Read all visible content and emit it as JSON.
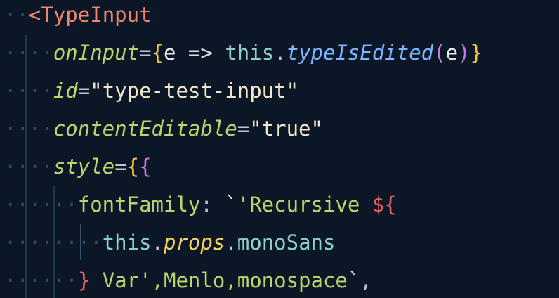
{
  "code": {
    "lines": [
      {
        "ws": "··",
        "tokens": [
          {
            "t": "<",
            "c": "tag"
          },
          {
            "t": "TypeInput",
            "c": "tag"
          }
        ]
      },
      {
        "ws": "····",
        "tokens": [
          {
            "t": "onInput",
            "c": "attr"
          },
          {
            "t": "=",
            "c": "eq"
          },
          {
            "t": "{",
            "c": "brace-y"
          },
          {
            "t": "e ",
            "c": "ident"
          },
          {
            "t": "=> ",
            "c": "arrow"
          },
          {
            "t": "this",
            "c": "kw"
          },
          {
            "t": ".",
            "c": "punct"
          },
          {
            "t": "typeIsEdited",
            "c": "method"
          },
          {
            "t": "(",
            "c": "paren"
          },
          {
            "t": "e",
            "c": "ident"
          },
          {
            "t": ")",
            "c": "paren"
          },
          {
            "t": "}",
            "c": "brace-y"
          }
        ]
      },
      {
        "ws": "····",
        "tokens": [
          {
            "t": "id",
            "c": "attr"
          },
          {
            "t": "=",
            "c": "eq"
          },
          {
            "t": "\"type-test-input\"",
            "c": "str"
          }
        ]
      },
      {
        "ws": "····",
        "tokens": [
          {
            "t": "contentEditable",
            "c": "attr"
          },
          {
            "t": "=",
            "c": "eq"
          },
          {
            "t": "\"true\"",
            "c": "str"
          }
        ]
      },
      {
        "ws": "····",
        "tokens": [
          {
            "t": "style",
            "c": "attr"
          },
          {
            "t": "=",
            "c": "eq"
          },
          {
            "t": "{",
            "c": "brace-y"
          },
          {
            "t": "{",
            "c": "brace-p"
          }
        ]
      },
      {
        "ws": "······",
        "tokens": [
          {
            "t": "fontFamily",
            "c": "prop"
          },
          {
            "t": ": ",
            "c": "punct"
          },
          {
            "t": "`",
            "c": "tick"
          },
          {
            "t": "'Recursive ",
            "c": "tmpl"
          },
          {
            "t": "${",
            "c": "brace-r"
          }
        ]
      },
      {
        "ws": "········",
        "tokens": [
          {
            "t": "this",
            "c": "kw"
          },
          {
            "t": ".",
            "c": "punct"
          },
          {
            "t": "props",
            "c": "props-it"
          },
          {
            "t": ".",
            "c": "punct"
          },
          {
            "t": "monoSans",
            "c": "member"
          }
        ]
      },
      {
        "ws": "······",
        "tokens": [
          {
            "t": "}",
            "c": "brace-r"
          },
          {
            "t": " Var',Menlo,monospace",
            "c": "tmpl"
          },
          {
            "t": "`",
            "c": "tick"
          },
          {
            "t": ",",
            "c": "punct"
          }
        ]
      }
    ]
  },
  "colors": {
    "background": "#0b1626",
    "tag": "#f0876d",
    "attribute": "#b7d66b",
    "method": "#7fb6ff",
    "string": "#f2e6c8"
  }
}
